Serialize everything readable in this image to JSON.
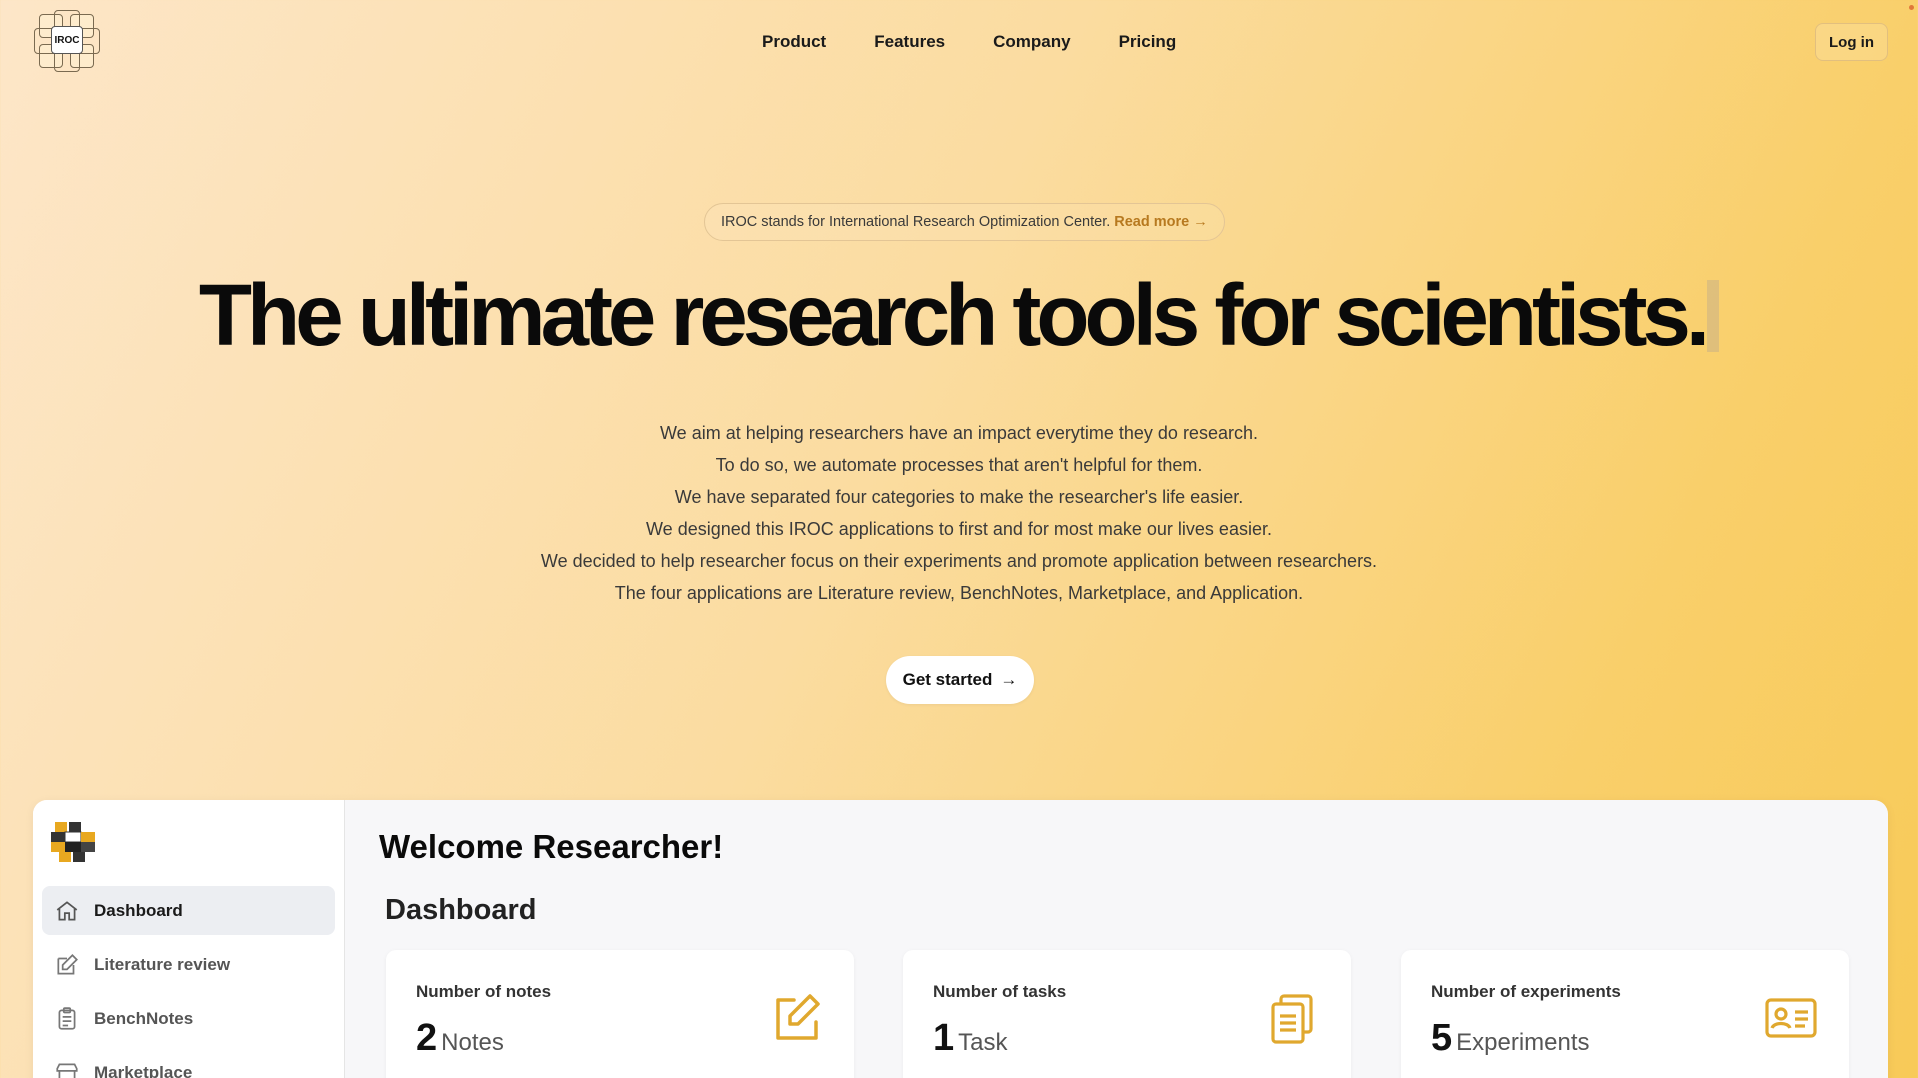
{
  "header": {
    "logo_text": "IROC",
    "nav": [
      "Product",
      "Features",
      "Company",
      "Pricing"
    ],
    "login_label": "Log in"
  },
  "hero": {
    "announcement": "IROC stands for International Research Optimization Center.",
    "announcement_link": "Read more →",
    "headline": "The ultimate research tools for scientists.",
    "paragraph": [
      "We aim at helping researchers have an impact everytime they do research.",
      "To do so, we automate processes that aren't helpful for them.",
      "We have separated four categories to make the researcher's life easier.",
      "We designed this IROC applications to first and for most make our lives easier.",
      "We decided to help researcher focus on their experiments and promote application between researchers.",
      "The four applications are Literature review, BenchNotes, Marketplace, and Application."
    ],
    "cta_label": "Get started",
    "cta_arrow": "→"
  },
  "app": {
    "welcome": "Welcome Researcher!",
    "dashboard_title": "Dashboard",
    "sidebar": [
      {
        "label": "Dashboard",
        "icon": "home-icon",
        "active": true
      },
      {
        "label": "Literature review",
        "icon": "pencil-square-icon",
        "active": false
      },
      {
        "label": "BenchNotes",
        "icon": "clipboard-icon",
        "active": false
      },
      {
        "label": "Marketplace",
        "icon": "store-icon",
        "active": false
      }
    ],
    "cards": [
      {
        "label": "Number of notes",
        "value": "2",
        "unit": "Notes",
        "icon": "edit-icon"
      },
      {
        "label": "Number of tasks",
        "value": "1",
        "unit": "Task",
        "icon": "clipboard-list-icon"
      },
      {
        "label": "Number of experiments",
        "value": "5",
        "unit": "Experiments",
        "icon": "id-card-icon"
      }
    ]
  },
  "colors": {
    "accent": "#e0a82e",
    "link": "#b7791f"
  }
}
